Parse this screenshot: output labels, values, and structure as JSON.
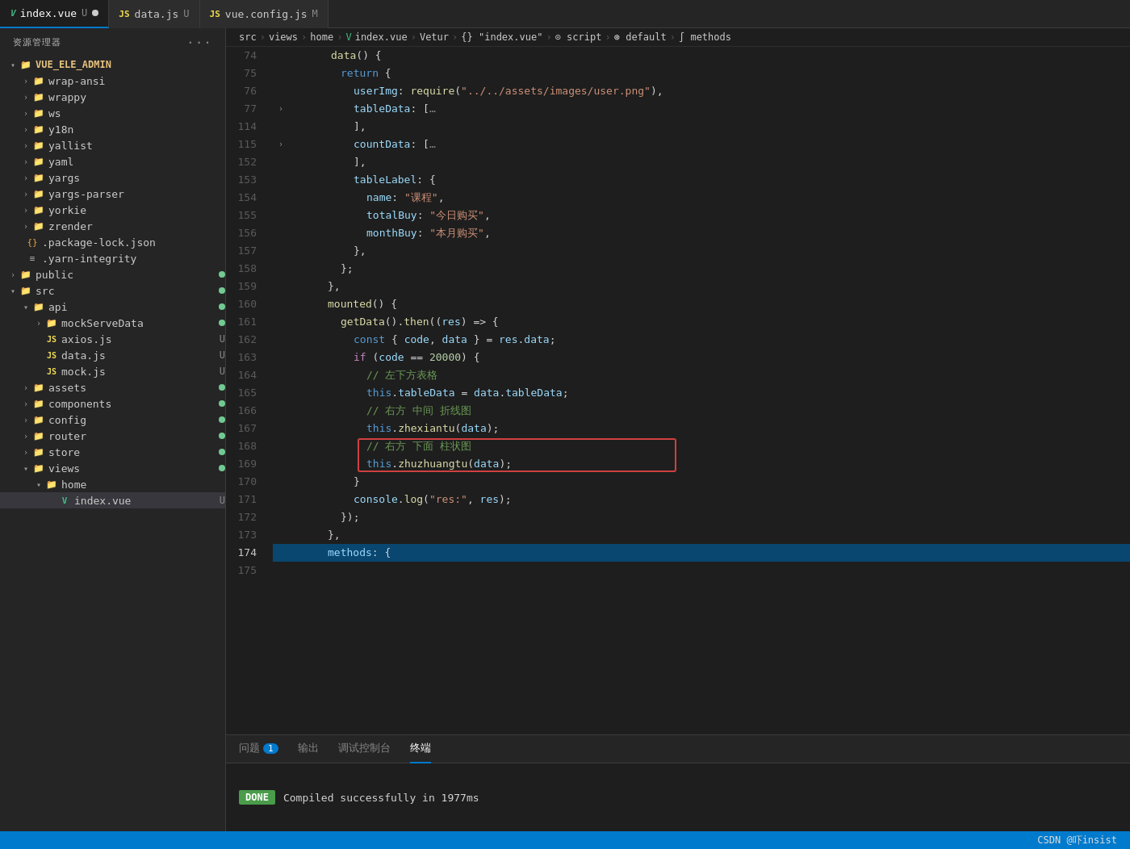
{
  "titleBar": {
    "tabs": [
      {
        "id": "index-vue",
        "icon": "vue",
        "label": "index.vue",
        "badge": "U",
        "active": true
      },
      {
        "id": "data-js",
        "icon": "js",
        "label": "data.js",
        "badge": "U",
        "active": false
      },
      {
        "id": "vue-config-js",
        "icon": "js",
        "label": "vue.config.js",
        "badge": "M",
        "active": false
      }
    ]
  },
  "sidebar": {
    "title": "资源管理器",
    "rootLabel": "VUE_ELE_ADMIN",
    "items": [
      {
        "id": "wrap-ansi",
        "label": "wrap-ansi",
        "type": "folder",
        "indent": 1
      },
      {
        "id": "wrappy",
        "label": "wrappy",
        "type": "folder",
        "indent": 1
      },
      {
        "id": "ws",
        "label": "ws",
        "type": "folder",
        "indent": 1
      },
      {
        "id": "y18n",
        "label": "y18n",
        "type": "folder",
        "indent": 1
      },
      {
        "id": "yallist",
        "label": "yallist",
        "type": "folder",
        "indent": 1
      },
      {
        "id": "yaml",
        "label": "yaml",
        "type": "folder",
        "indent": 1
      },
      {
        "id": "yargs",
        "label": "yargs",
        "type": "folder",
        "indent": 1
      },
      {
        "id": "yargs-parser",
        "label": "yargs-parser",
        "type": "folder",
        "indent": 1
      },
      {
        "id": "yorkie",
        "label": "yorkie",
        "type": "folder",
        "indent": 1
      },
      {
        "id": "zrender",
        "label": "zrender",
        "type": "folder",
        "indent": 1
      },
      {
        "id": "package-lock-json",
        "label": ".package-lock.json",
        "type": "json",
        "indent": 0
      },
      {
        "id": "yarn-integrity",
        "label": ".yarn-integrity",
        "type": "list",
        "indent": 0
      },
      {
        "id": "public",
        "label": "public",
        "type": "folder",
        "indent": 0,
        "badge": "green"
      },
      {
        "id": "src",
        "label": "src",
        "type": "folder",
        "indent": 0,
        "open": true,
        "badge": "green"
      },
      {
        "id": "api",
        "label": "api",
        "type": "folder",
        "indent": 1,
        "open": true,
        "badge": "green"
      },
      {
        "id": "mockServeData",
        "label": "mockServeData",
        "type": "folder",
        "indent": 2,
        "badge": "green"
      },
      {
        "id": "axios-js",
        "label": "axios.js",
        "type": "js",
        "indent": 2,
        "badge": "yellow",
        "modifier": "U"
      },
      {
        "id": "data-js",
        "label": "data.js",
        "type": "js",
        "indent": 2,
        "badge": "yellow",
        "modifier": "U"
      },
      {
        "id": "mock-js",
        "label": "mock.js",
        "type": "js",
        "indent": 2,
        "badge": "yellow",
        "modifier": "U"
      },
      {
        "id": "assets",
        "label": "assets",
        "type": "folder",
        "indent": 1,
        "badge": "green"
      },
      {
        "id": "components",
        "label": "components",
        "type": "folder",
        "indent": 1,
        "badge": "green"
      },
      {
        "id": "config",
        "label": "config",
        "type": "folder",
        "indent": 1,
        "badge": "green"
      },
      {
        "id": "router",
        "label": "router",
        "type": "folder",
        "indent": 1,
        "badge": "green"
      },
      {
        "id": "store",
        "label": "store",
        "type": "folder",
        "indent": 1,
        "badge": "green"
      },
      {
        "id": "views",
        "label": "views",
        "type": "folder",
        "indent": 1,
        "open": true,
        "badge": "green"
      },
      {
        "id": "home",
        "label": "home",
        "type": "folder",
        "indent": 2,
        "open": true
      },
      {
        "id": "index-vue",
        "label": "index.vue",
        "type": "vue",
        "indent": 3,
        "modifier": "U",
        "active": true
      }
    ]
  },
  "breadcrumb": {
    "parts": [
      "src",
      ">",
      "views",
      ">",
      "home",
      ">",
      "index.vue",
      ">",
      "Vetur",
      ">",
      "{} \"index.vue\"",
      ">",
      "script",
      ">",
      "default",
      ">",
      "methods"
    ]
  },
  "editor": {
    "lines": [
      {
        "num": 74,
        "content": "data() {",
        "indent": 3
      },
      {
        "num": 75,
        "content": "return {",
        "indent": 4
      },
      {
        "num": 76,
        "content": "userImg: require(\"../../assets/images/user.png\"),",
        "indent": 5
      },
      {
        "num": 77,
        "content": "tableData: […",
        "indent": 5,
        "folded": true
      },
      {
        "num": 114,
        "content": "],",
        "indent": 5
      },
      {
        "num": 115,
        "content": "countData: […",
        "indent": 5,
        "folded": true
      },
      {
        "num": 152,
        "content": "],",
        "indent": 5
      },
      {
        "num": 153,
        "content": "tableLabel: {",
        "indent": 5
      },
      {
        "num": 154,
        "content": "name: \"课程\",",
        "indent": 6
      },
      {
        "num": 155,
        "content": "totalBuy: \"今日购买\",",
        "indent": 6
      },
      {
        "num": 156,
        "content": "monthBuy: \"本月购买\",",
        "indent": 6
      },
      {
        "num": 157,
        "content": "},",
        "indent": 5
      },
      {
        "num": 158,
        "content": "};",
        "indent": 4
      },
      {
        "num": 159,
        "content": "},",
        "indent": 3
      },
      {
        "num": 160,
        "content": "mounted() {",
        "indent": 3
      },
      {
        "num": 161,
        "content": "getData().then((res) => {",
        "indent": 4
      },
      {
        "num": 162,
        "content": "const { code, data } = res.data;",
        "indent": 5
      },
      {
        "num": 163,
        "content": "if (code == 20000) {",
        "indent": 5
      },
      {
        "num": 164,
        "content": "// 左下方表格",
        "indent": 6
      },
      {
        "num": 165,
        "content": "this.tableData = data.tableData;",
        "indent": 6
      },
      {
        "num": 166,
        "content": "// 右方 中间 折线图",
        "indent": 6
      },
      {
        "num": 167,
        "content": "this.zhexiantu(data);",
        "indent": 6
      },
      {
        "num": 168,
        "content": "// 右方 下面 柱状图",
        "indent": 6,
        "highlighted": true
      },
      {
        "num": 169,
        "content": "this.zhuzhuangtu(data);",
        "indent": 6,
        "highlighted": true
      },
      {
        "num": 170,
        "content": "}",
        "indent": 5
      },
      {
        "num": 171,
        "content": "console.log(\"res:\", res);",
        "indent": 5
      },
      {
        "num": 172,
        "content": "});",
        "indent": 4
      },
      {
        "num": 173,
        "content": "},",
        "indent": 3
      },
      {
        "num": 174,
        "content": "methods: {",
        "indent": 3
      }
    ]
  },
  "bottomPanel": {
    "tabs": [
      {
        "id": "problems",
        "label": "问题",
        "badge": "1"
      },
      {
        "id": "output",
        "label": "输出"
      },
      {
        "id": "debug-console",
        "label": "调试控制台"
      },
      {
        "id": "terminal",
        "label": "终端",
        "active": true
      }
    ],
    "terminalContent": {
      "doneBadge": "DONE",
      "message": "Compiled successfully in 1977ms"
    }
  },
  "statusBar": {
    "right": "CSDN @吓insist"
  }
}
